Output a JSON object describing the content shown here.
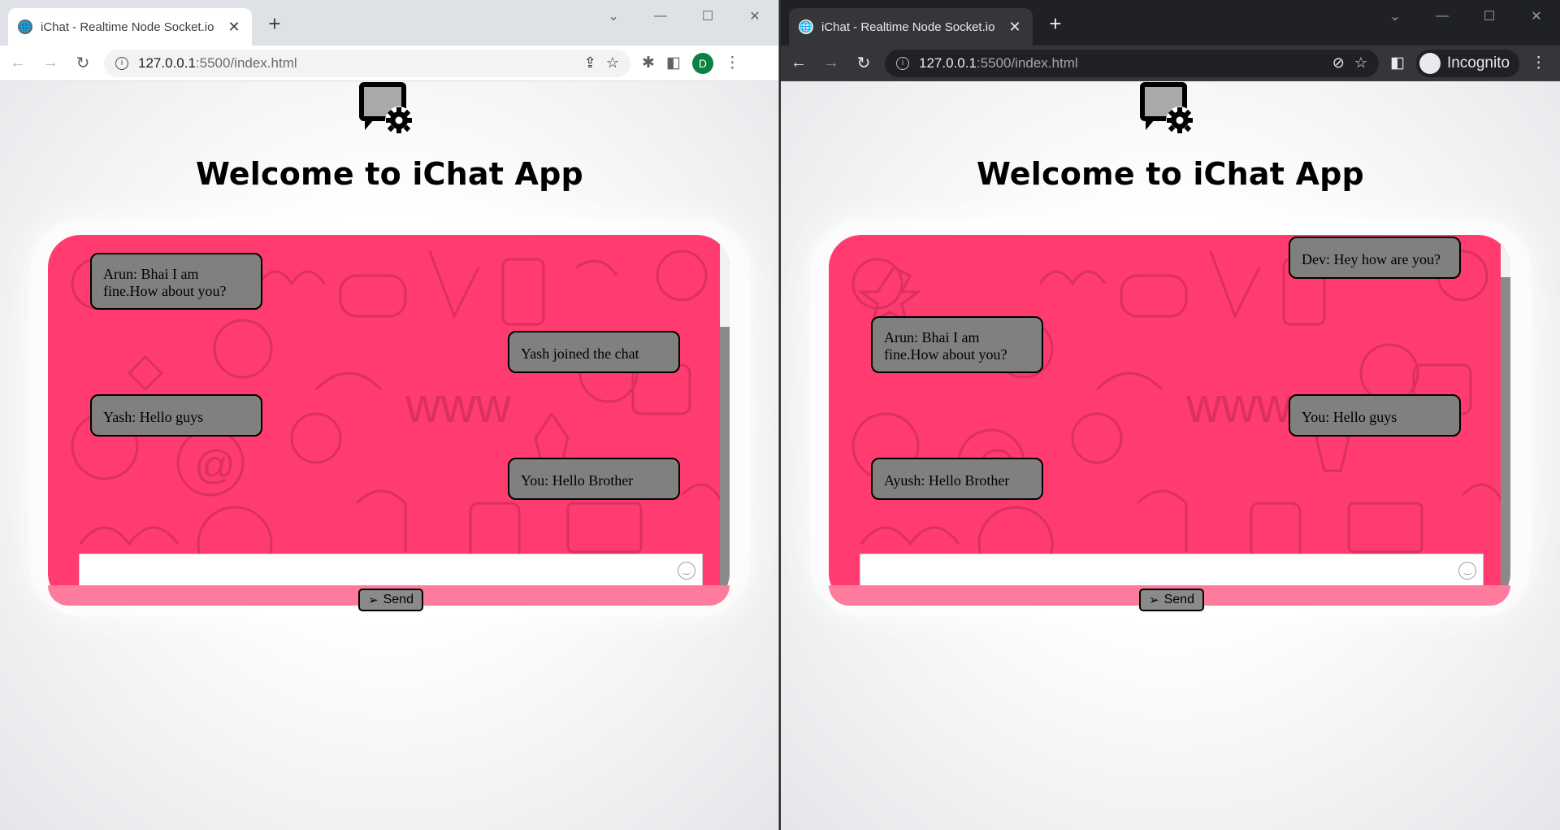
{
  "windows": [
    {
      "theme": "light",
      "tab_title": "iChat - Realtime Node Socket.io",
      "url_host": "127.0.0.1",
      "url_path": ":5500/index.html",
      "profile_initial": "D",
      "page": {
        "heading": "Welcome to iChat App",
        "send_label": "Send",
        "messages": [
          {
            "side": "left",
            "text": "Arun: Bhai I am fine.How about you?"
          },
          {
            "side": "right",
            "text": "Yash joined the chat"
          },
          {
            "side": "left",
            "text": "Yash: Hello guys"
          },
          {
            "side": "right",
            "text": "You: Hello Brother"
          }
        ],
        "scroll_position": 0.28
      }
    },
    {
      "theme": "dark",
      "tab_title": "iChat - Realtime Node Socket.io",
      "url_host": "127.0.0.1",
      "url_path": ":5500/index.html",
      "incognito_label": "Incognito",
      "page": {
        "heading": "Welcome to iChat App",
        "send_label": "Send",
        "messages": [
          {
            "side": "right",
            "text": "Dev: Hey how are you?"
          },
          {
            "side": "left",
            "text": "Arun: Bhai I am fine.How about you?"
          },
          {
            "side": "right",
            "text": "You: Hello guys"
          },
          {
            "side": "left",
            "text": "Ayush: Hello Brother"
          }
        ],
        "scroll_position": 0.12
      }
    }
  ],
  "colors": {
    "chat_bg": "#ff3b6f",
    "bubble": "#808080",
    "send_button": "#8a8a8a"
  },
  "icons": {
    "favicon": "globe-icon",
    "logo": "chat-settings-icon",
    "send": "paper-plane-icon",
    "emoji": "smiley-icon"
  }
}
